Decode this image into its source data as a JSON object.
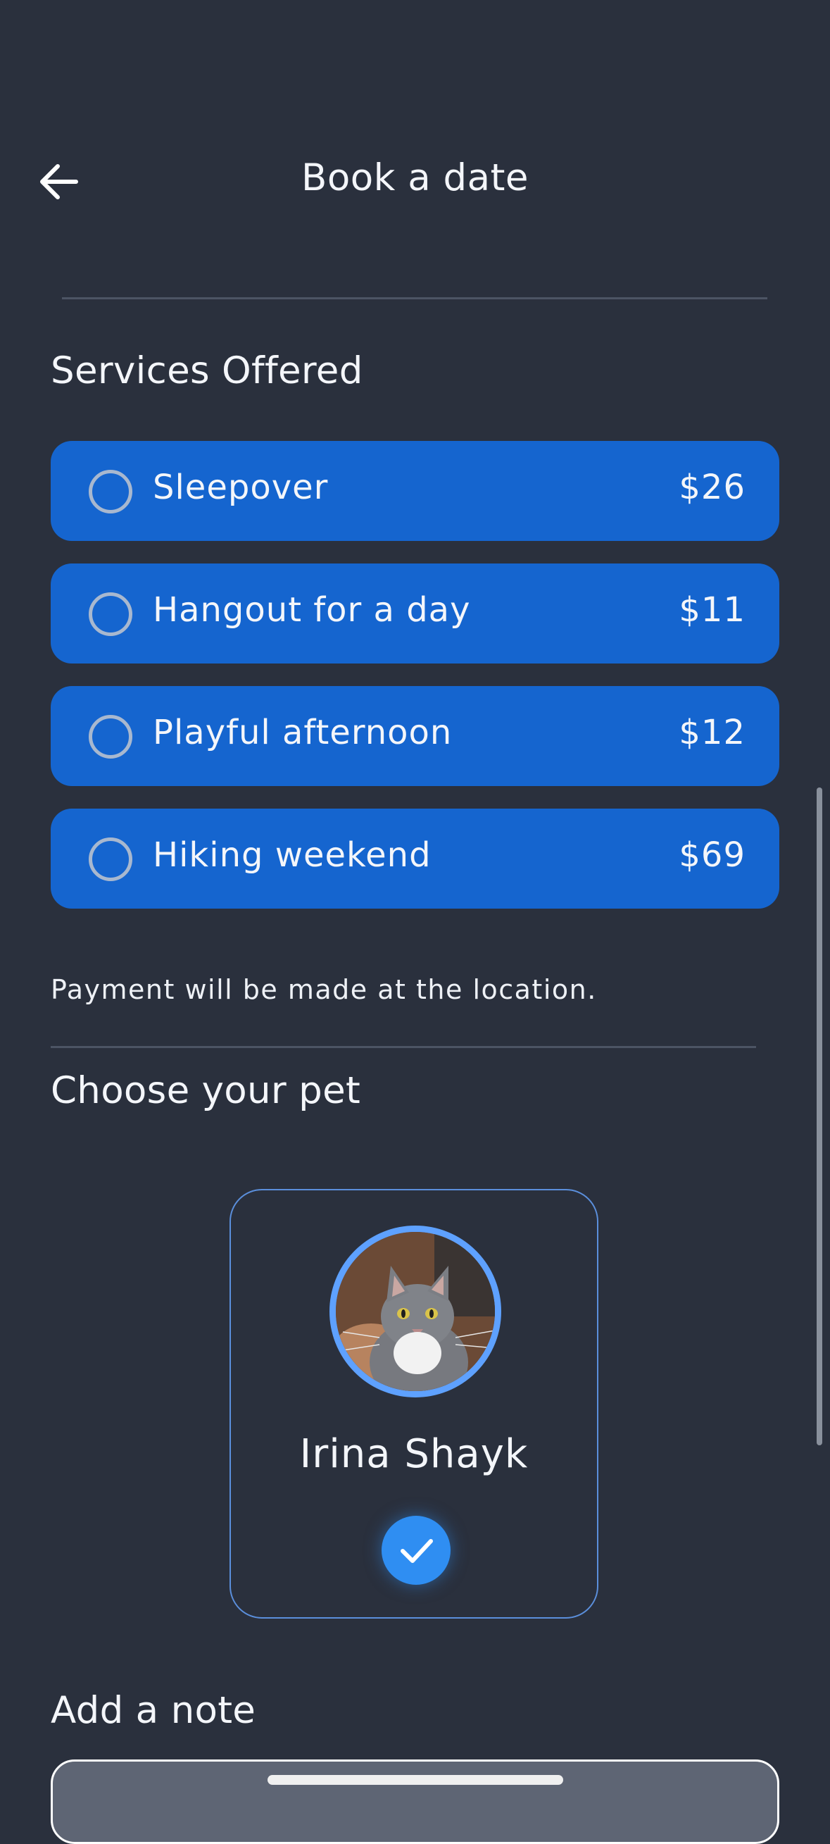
{
  "header": {
    "title": "Book a date",
    "back_icon": "arrow-left-icon"
  },
  "services": {
    "title": "Services Offered",
    "items": [
      {
        "name": "Sleepover",
        "price": "$26",
        "selected": false
      },
      {
        "name": "Hangout for a day",
        "price": "$11",
        "selected": false
      },
      {
        "name": "Playful afternoon",
        "price": "$12",
        "selected": false
      },
      {
        "name": "Hiking weekend",
        "price": "$69",
        "selected": false
      }
    ],
    "payment_note": "Payment will be made at the location."
  },
  "pets": {
    "title": "Choose your pet",
    "items": [
      {
        "name": "Irina Shayk",
        "selected": true,
        "icon": "check-icon"
      }
    ]
  },
  "note": {
    "title": "Add a note"
  },
  "colors": {
    "background": "#2a303d",
    "service_row": "#1565cf",
    "accent": "#2f8ef2",
    "avatar_ring": "#5ea1ff",
    "card_border": "#5b8fdc"
  }
}
